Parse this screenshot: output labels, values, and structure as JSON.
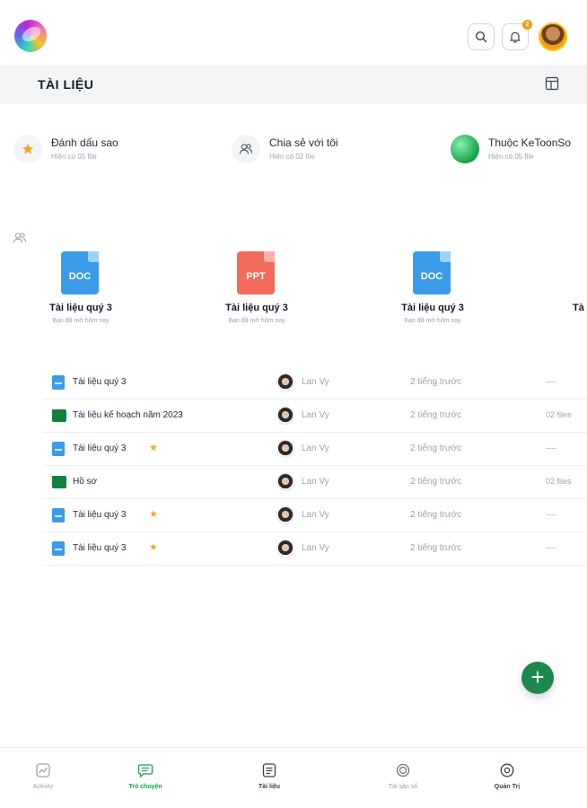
{
  "header": {
    "section_title": "TÀI LIỆU",
    "notification_count": "2"
  },
  "quick_access": [
    {
      "title": "Đánh dấu sao",
      "subtitle": "Hiện có 05 file",
      "icon": "star-icon"
    },
    {
      "title": "Chia sẻ với tôi",
      "subtitle": "Hiện có 02 file",
      "icon": "users-icon"
    },
    {
      "title": "Thuộc KeToonSo",
      "subtitle": "Hiện có 05 file",
      "icon": "green-circle"
    }
  ],
  "cards": [
    {
      "ext": "DOC",
      "title": "Tài liệu quý 3",
      "subtitle": "Bạn đã mở hôm nay"
    },
    {
      "ext": "PPT",
      "title": "Tài liệu quý 3",
      "subtitle": "Bạn đã mở hôm nay"
    },
    {
      "ext": "DOC",
      "title": "Tài liệu quý 3",
      "subtitle": "Bạn đã mở hôm nay"
    },
    {
      "ext": "",
      "title": "Tà",
      "subtitle": ""
    }
  ],
  "files": [
    {
      "type": "doc",
      "name": "Tài liệu quý 3",
      "starred": false,
      "owner": "Lan Vy",
      "time": "2 tiếng trước",
      "size": "----"
    },
    {
      "type": "folder",
      "name": "Tài liệu kế hoạch năm 2023",
      "starred": false,
      "owner": "Lan Vy",
      "time": "2 tiếng trước",
      "size": "02 files"
    },
    {
      "type": "doc",
      "name": "Tài liệu quý 3",
      "starred": true,
      "owner": "Lan Vy",
      "time": "2 tiếng trước",
      "size": "----"
    },
    {
      "type": "folder",
      "name": "Hồ sơ",
      "starred": false,
      "owner": "Lan Vy",
      "time": "2 tiếng trước",
      "size": "02 files"
    },
    {
      "type": "doc",
      "name": "Tài liệu quý 3",
      "starred": true,
      "owner": "Lan Vy",
      "time": "2 tiếng trước",
      "size": "----"
    },
    {
      "type": "doc",
      "name": "Tài liệu quý 3",
      "starred": true,
      "owner": "Lan Vy",
      "time": "2 tiếng trước",
      "size": "----"
    }
  ],
  "fab": {
    "label": "+"
  },
  "bottom_nav": [
    {
      "label": "Activity",
      "icon": "activity-icon",
      "active": false
    },
    {
      "label": "Trò chuyện",
      "icon": "chat-icon",
      "active": true
    },
    {
      "label": "Tài liệu",
      "icon": "document-icon",
      "active": false
    },
    {
      "label": "Tài sản số",
      "icon": "asset-icon",
      "active": false
    },
    {
      "label": "Quản Trị",
      "icon": "settings-icon",
      "active": false
    }
  ],
  "colors": {
    "accent": "#1e874b",
    "active_nav": "#16a34a",
    "doc": "#3b9be8",
    "ppt": "#f26b5b",
    "star": "#f5a623",
    "badge": "#f59e0b"
  }
}
